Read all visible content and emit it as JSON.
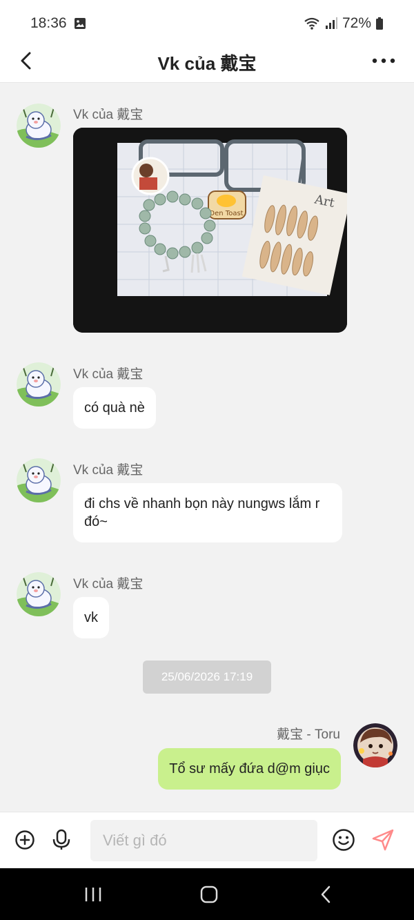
{
  "status": {
    "time": "18:36",
    "battery": "72%"
  },
  "header": {
    "title": "Vk của 戴宝"
  },
  "messages": [
    {
      "sender": "Vk của 戴宝",
      "kind": "image"
    },
    {
      "sender": "Vk của 戴宝",
      "text": "có quà nè"
    },
    {
      "sender": "Vk của 戴宝",
      "text": "đi chs về nhanh bọn này nungws lắm r đó~"
    },
    {
      "sender": "Vk của 戴宝",
      "text": "vk"
    }
  ],
  "timestamp": "25/06/2026 17:19",
  "my_message": {
    "sender": "戴宝 - Toru",
    "text": "Tổ sư mấy đứa d@m giục"
  },
  "photo": {
    "text_toast": "Den Toast",
    "text_art": "Art"
  },
  "input": {
    "placeholder": "Viết gì đó"
  },
  "colors": {
    "my_bubble": "#c9f08d",
    "send_accent": "#ff8a8a",
    "background": "#f2f2f2"
  }
}
